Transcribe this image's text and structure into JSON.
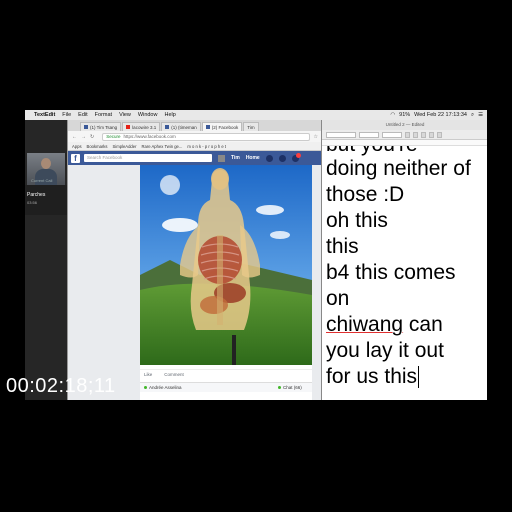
{
  "menubar": {
    "app": "TextEdit",
    "items": [
      "File",
      "Edit",
      "Format",
      "View",
      "Window",
      "Help"
    ],
    "clock": "Wed Feb 22 17:13:34",
    "battery": "91%"
  },
  "call": {
    "subtitle": "Current Call",
    "name": "Parches",
    "duration": "03:56"
  },
  "browser": {
    "tabs": [
      {
        "label": "(1) Tim Tsang",
        "icon": "facebook"
      },
      {
        "label": "lacowire 3.1",
        "icon": "youtube"
      },
      {
        "label": "(1) (timeman",
        "icon": "facebook"
      },
      {
        "label": "(2) Facebook",
        "icon": "facebook"
      },
      {
        "label": "Tim",
        "icon": "none"
      }
    ],
    "url_prefix": "Secure",
    "url": "https://www.facebook.com",
    "bookmarks": [
      "Apps",
      "Bookmarks",
      "SimpleAdder",
      "Rare Aphex Twin ge...",
      "m o n k - p r o p h e t"
    ]
  },
  "facebook": {
    "search_placeholder": "Search Facebook",
    "user": "Tim",
    "home": "Home",
    "like": "Like",
    "comment": "Comment",
    "friend": "Andrée Asselina",
    "chat": "Chat (66)"
  },
  "textedit": {
    "title": "Untitled 2 — Edited",
    "lines": [
      {
        "text": "but you're",
        "misspelled": false
      },
      {
        "text": "doing neither of",
        "misspelled": false
      },
      {
        "text": "those :D",
        "misspelled": false
      },
      {
        "text": "oh this",
        "misspelled": false
      },
      {
        "text": "this",
        "misspelled": false
      },
      {
        "text": "b4 this comes",
        "misspelled": false
      },
      {
        "text": "on",
        "misspelled": false
      },
      {
        "text": "chiwang can",
        "misspelled": true,
        "wrong_word": "chiwang",
        "rest": " can"
      },
      {
        "text": "you lay it out",
        "misspelled": false
      },
      {
        "text": "for us this",
        "misspelled": false
      }
    ]
  },
  "timecode": "00:02:18;11",
  "colors": {
    "facebook_blue": "#3b5998",
    "end_call": "#e0312f",
    "info_call": "#1e7bd6",
    "spellcheck": "#e03030"
  }
}
